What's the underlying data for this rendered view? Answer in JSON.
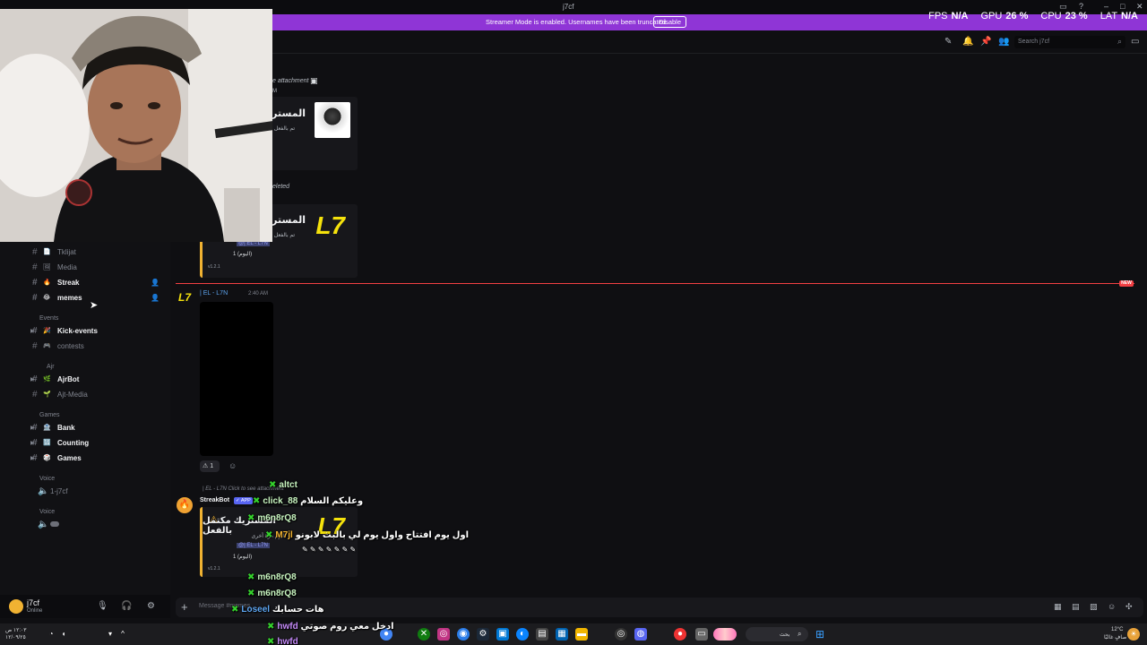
{
  "window": {
    "title": "j7cf"
  },
  "banner": {
    "text": "Streamer Mode is enabled. Usernames have been truncated.",
    "button": "Disable"
  },
  "stats": [
    {
      "label": "FPS",
      "value": "N/A"
    },
    {
      "label": "GPU",
      "value": "26 %"
    },
    {
      "label": "CPU",
      "value": "23 %"
    },
    {
      "label": "LAT",
      "value": "N/A"
    }
  ],
  "header": {
    "search_placeholder": "Search j7cf"
  },
  "sidebar": {
    "channels": [
      {
        "name": "Tklijat",
        "emoji": "📄"
      },
      {
        "name": "Media",
        "emoji": "🖼"
      },
      {
        "name": "Streak",
        "emoji": "🔥"
      },
      {
        "name": "memes",
        "emoji": "😂"
      }
    ],
    "events_category": "Events",
    "events": [
      {
        "name": "Kick-events",
        "emoji": "🎉"
      },
      {
        "name": "contests",
        "emoji": "🎮"
      }
    ],
    "ajr_category": "Ajr",
    "ajr": [
      {
        "name": "AjrBot",
        "emoji": "🌿"
      },
      {
        "name": "Ajt-Media",
        "emoji": "🌱"
      }
    ],
    "games_category": "Games",
    "games": [
      {
        "name": "Bank",
        "emoji": "🏦"
      },
      {
        "name": "Counting",
        "emoji": "🔢"
      },
      {
        "name": "Games",
        "emoji": "🎲"
      }
    ],
    "voice1_category": "Voice",
    "voice1": "1-j7cf",
    "voice2_category": "Voice"
  },
  "user": {
    "name": "j7cf",
    "status": "Online"
  },
  "messages": {
    "attach1": "e attachment",
    "attach1_time": "M",
    "embed1_title": "المستريك مـ",
    "embed1_sub": "تم بالفعل بدء",
    "deleted": "eleted",
    "embed2_title": "المستريك مـ",
    "embed2_sub": "تم بالفعل بدء",
    "embed2_mention": "@| EL - L7N",
    "embed2_day": "1 (اليوم)",
    "embed2_version": "v1.2.1",
    "new_badge": "NEW",
    "author": "| EL - L7N",
    "author_time": "2:40 AM",
    "reaction_count": "1",
    "reply_preview": "| EL - L7N Click to see attachment",
    "bot_name": "StreakBot",
    "bot_tag": "✓ APP",
    "embed3_title": "المستريك مكتمل بالفعل",
    "embed3_sub": "اليوم مرة أخرى",
    "embed3_mention": "@| EL - L7N",
    "embed3_day": "1 (اليوم)",
    "embed3_version": "v1.2.1",
    "input_placeholder": "Message #memes"
  },
  "chat_overlay": [
    {
      "user": "altct",
      "text": ""
    },
    {
      "user": "click_88",
      "text": "وعليكم السلام"
    },
    {
      "user": "m6n8rQ8",
      "text": ""
    },
    {
      "user": "M7jl",
      "text": "اول يوم افتتاح واول يوم لي بالبث لابونو"
    },
    {
      "user": "m6n8rQ8",
      "text": ""
    },
    {
      "user": "m6n8rQ8",
      "text": ""
    },
    {
      "user": "Loseel",
      "text": "هات حسابك"
    },
    {
      "user": "hwfd",
      "text": "ادخل معي روم صوتي"
    },
    {
      "user": "hwfd",
      "text": ""
    }
  ],
  "taskbar": {
    "time": "١٢:٠٣ ص",
    "date": "١٢/٠٩/٢٥",
    "weather": "12°C",
    "weather_text": "صافٍ غالبًا",
    "search": "بحث"
  }
}
